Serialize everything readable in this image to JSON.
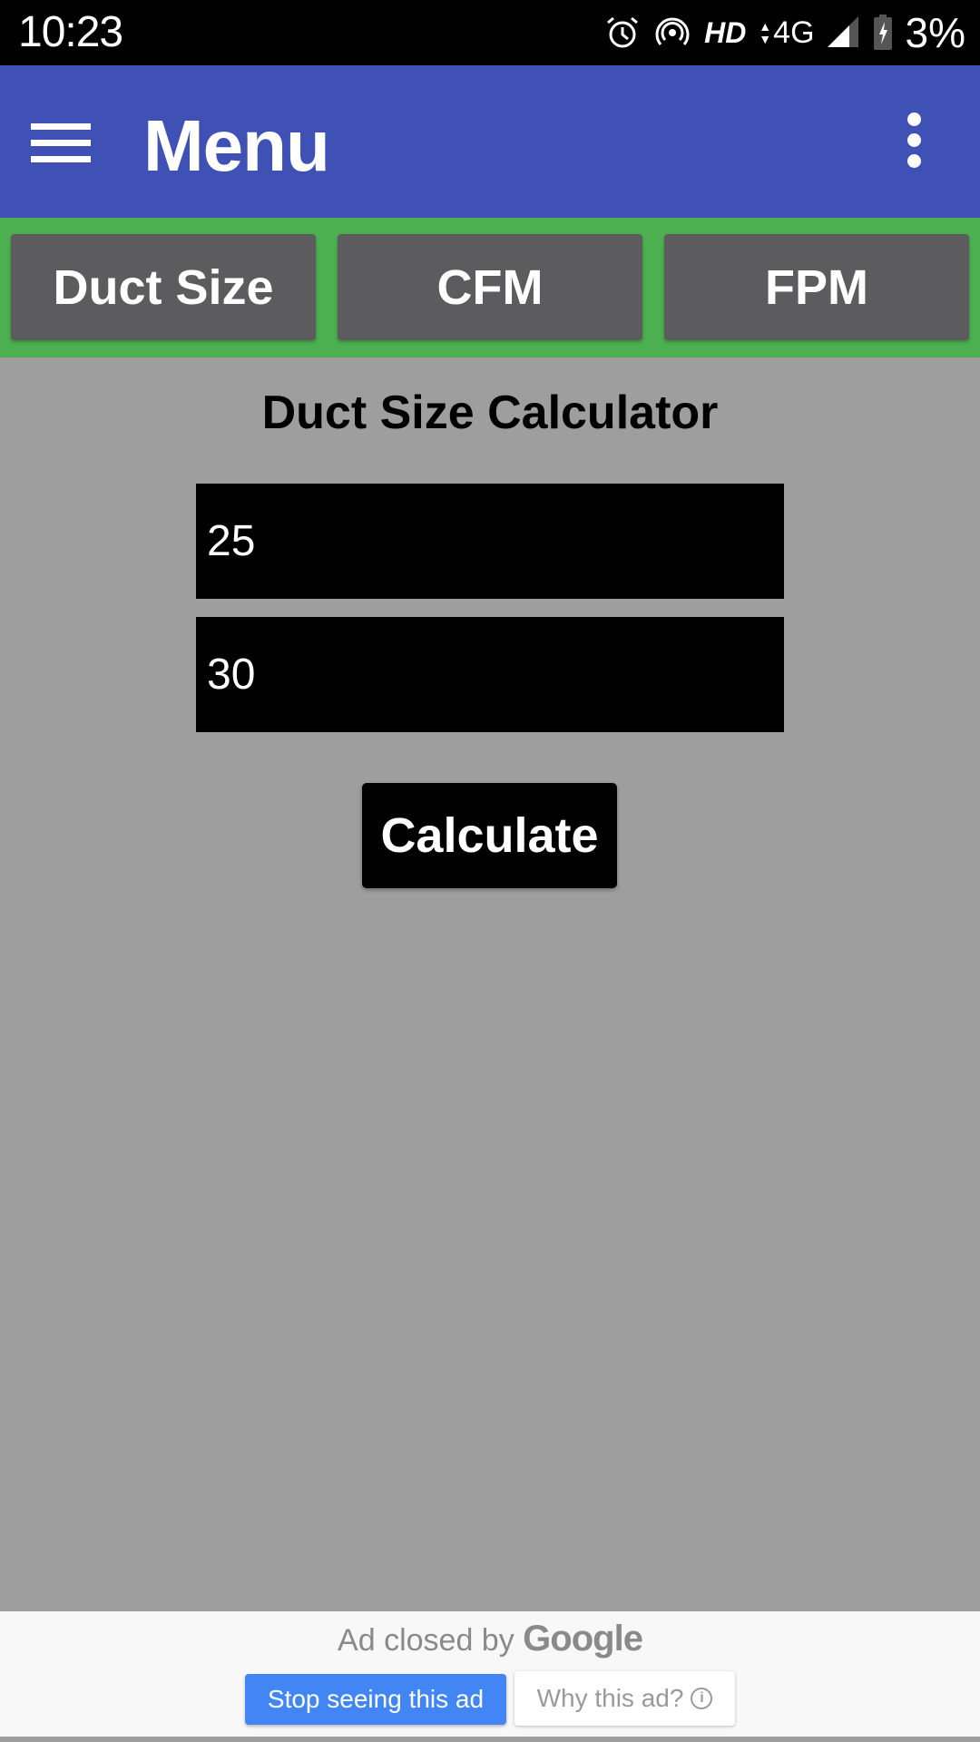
{
  "status_bar": {
    "time": "10:23",
    "icons": [
      "alarm-icon",
      "hotspot-icon",
      "hd-voice-icon",
      "data-arrows-icon",
      "signal-icon",
      "battery-charging-icon"
    ],
    "hd_label": "HD",
    "network_label": "4G",
    "battery_percent": "3%"
  },
  "app_bar": {
    "title": "Menu",
    "menu_icon": "hamburger-icon",
    "overflow_icon": "more-vert-icon",
    "color": "#3f51b5"
  },
  "tabs": {
    "background_color": "#4caf50",
    "items": [
      {
        "label": "Duct Size"
      },
      {
        "label": "CFM"
      },
      {
        "label": "FPM"
      }
    ]
  },
  "calculator": {
    "title": "Duct Size Calculator",
    "inputs": [
      {
        "value": "25"
      },
      {
        "value": "30"
      }
    ],
    "calculate_label": "Calculate"
  },
  "ad": {
    "closed_text": "Ad closed by",
    "brand": "Google",
    "stop_label": "Stop seeing this ad",
    "why_label": "Why this ad?",
    "info_icon": "i",
    "stop_color": "#4285f4"
  }
}
